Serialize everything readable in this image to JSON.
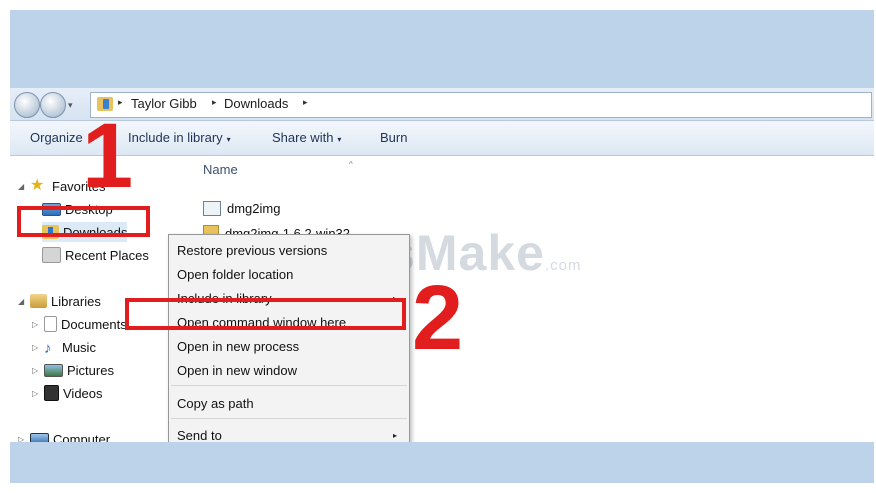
{
  "address": {
    "crumbs": [
      "Taylor Gibb",
      "Downloads"
    ],
    "separator": "▸",
    "dropdown": "▾"
  },
  "toolbar": {
    "organize": "Organize",
    "include": "Include in library",
    "share": "Share with",
    "burn": "Burn",
    "arrow": "▾"
  },
  "nav": {
    "expand": "◢",
    "collapsed": "▷",
    "favorites": "Favorites",
    "desktop": "Desktop",
    "downloads": "Downloads",
    "recent": "Recent Places",
    "libraries": "Libraries",
    "documents": "Documents",
    "music": "Music",
    "pictures": "Pictures",
    "videos": "Videos",
    "computer": "Computer"
  },
  "content": {
    "column_name": "Name",
    "sort_caret": "^",
    "files": [
      "dmg2img",
      "dmg2img-1.6.2-win32"
    ]
  },
  "context_menu": {
    "items": [
      "Restore previous versions",
      "Open folder location",
      "Include in library",
      "Open command window here",
      "Open in new process",
      "Open in new window",
      "Copy as path",
      "Send to"
    ],
    "submenu_arrow": "▸"
  },
  "annotations": {
    "step1": "1",
    "step2": "2",
    "color": "#e11d1d"
  },
  "watermark": {
    "brand": "TipsMake",
    "suffix": ".com"
  }
}
